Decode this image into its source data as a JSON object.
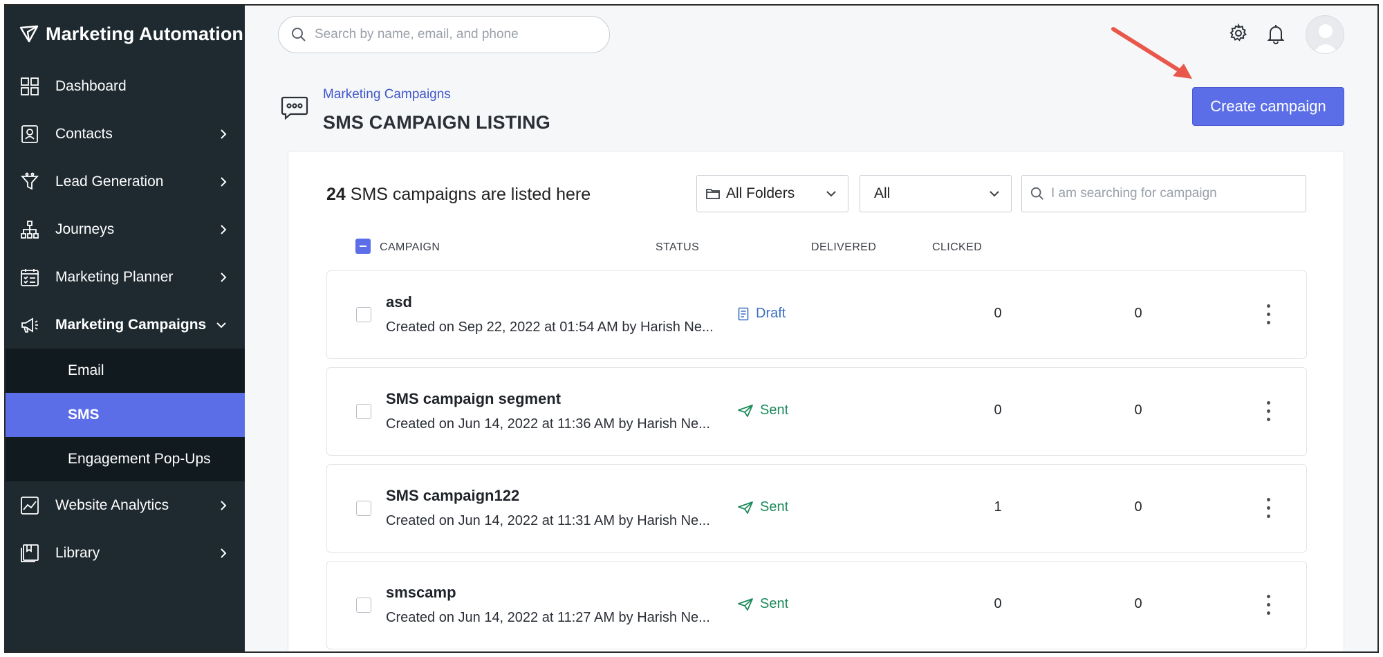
{
  "sidebar": {
    "brand": "Marketing Automation",
    "items": [
      {
        "label": "Dashboard",
        "icon": "dashboard-icon"
      },
      {
        "label": "Contacts",
        "icon": "contacts-icon"
      },
      {
        "label": "Lead Generation",
        "icon": "funnel-icon"
      },
      {
        "label": "Journeys",
        "icon": "journey-icon"
      },
      {
        "label": "Marketing Planner",
        "icon": "planner-icon"
      },
      {
        "label": "Marketing Campaigns",
        "icon": "megaphone-icon"
      },
      {
        "label": "Website Analytics",
        "icon": "analytics-icon"
      },
      {
        "label": "Library",
        "icon": "library-icon"
      }
    ],
    "submenu": [
      {
        "label": "Email"
      },
      {
        "label": "SMS"
      },
      {
        "label": "Engagement Pop-Ups"
      }
    ],
    "active_sub": "SMS"
  },
  "topbar": {
    "search_placeholder": "Search by name, email, and phone"
  },
  "header": {
    "breadcrumb": "Marketing Campaigns",
    "title": "SMS CAMPAIGN LISTING",
    "create_button": "Create campaign"
  },
  "listing": {
    "count": "24",
    "count_text": "SMS campaigns are listed here",
    "folder_filter": "All Folders",
    "status_filter": "All",
    "search_placeholder": "I am searching for campaign",
    "columns": {
      "campaign": "CAMPAIGN",
      "status": "STATUS",
      "delivered": "DELIVERED",
      "clicked": "CLICKED"
    },
    "rows": [
      {
        "name": "asd",
        "meta": "Created on Sep 22, 2022 at 01:54 AM by Harish Ne...",
        "status": "Draft",
        "delivered": "0",
        "clicked": "0"
      },
      {
        "name": "SMS campaign segment",
        "meta": "Created on Jun 14, 2022 at 11:36 AM by Harish Ne...",
        "status": "Sent",
        "delivered": "0",
        "clicked": "0"
      },
      {
        "name": "SMS campaign122",
        "meta": "Created on Jun 14, 2022 at 11:31 AM by Harish Ne...",
        "status": "Sent",
        "delivered": "1",
        "clicked": "0"
      },
      {
        "name": "smscamp",
        "meta": "Created on Jun 14, 2022 at 11:27 AM by Harish Ne...",
        "status": "Sent",
        "delivered": "0",
        "clicked": "0"
      }
    ]
  },
  "colors": {
    "sidebar_bg": "#1e2a30",
    "accent": "#5b6ee8",
    "sent": "#1d8a5c",
    "draft": "#3b6fc4",
    "annotation_arrow": "#e8574a"
  }
}
